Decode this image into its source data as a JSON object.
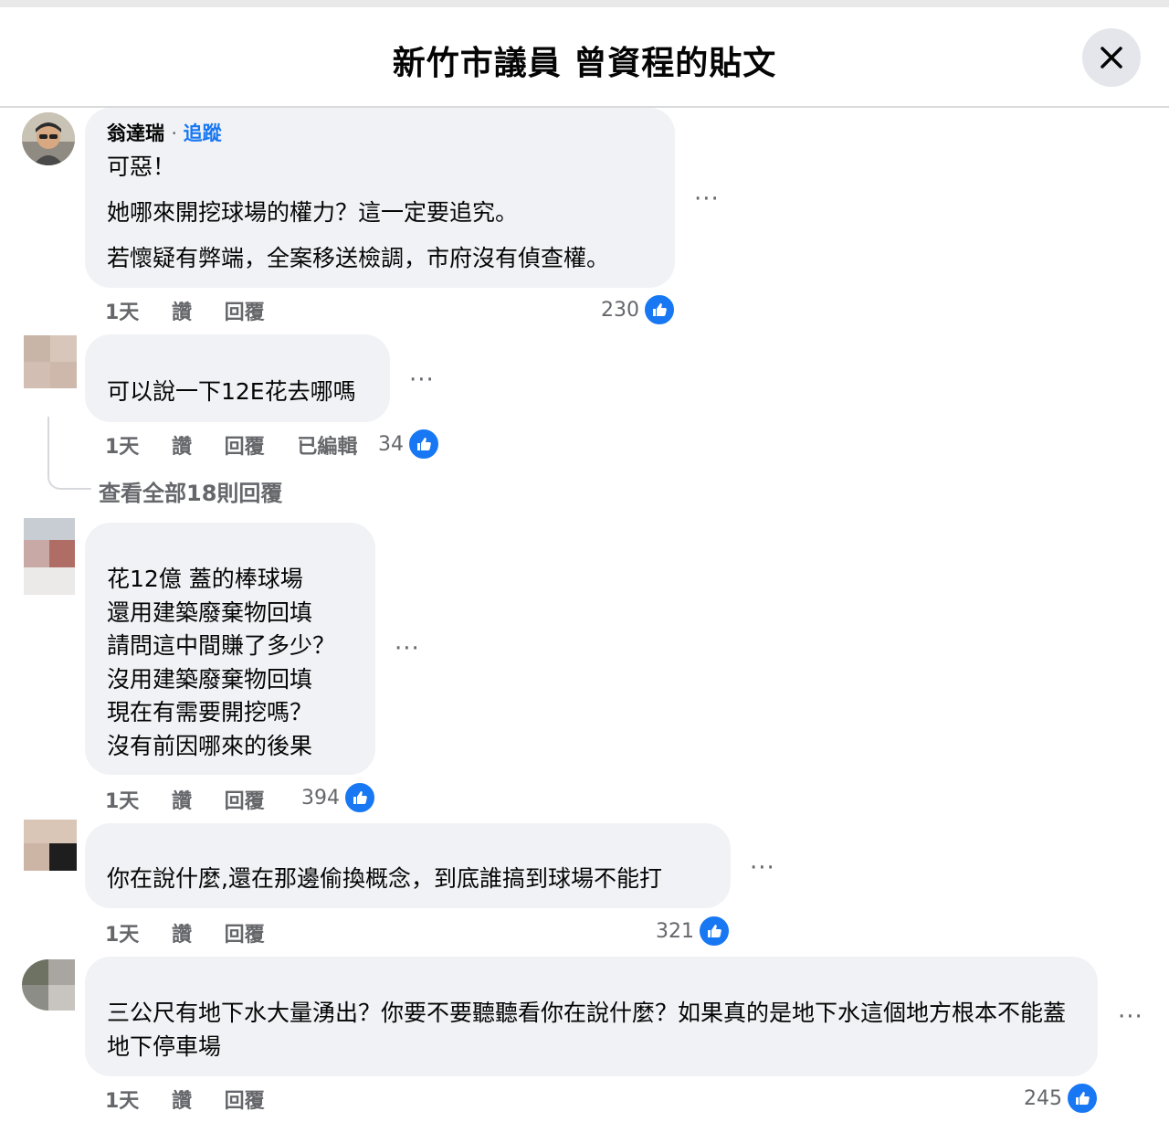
{
  "dialog": {
    "title": "新竹市議員 曾資程的貼文"
  },
  "comments": [
    {
      "author": "翁達瑞",
      "follow_label": "追蹤",
      "lines": [
        "可惡！",
        "她哪來開挖球場的權力？這一定要追究。",
        "若懷疑有弊端，全案移送檢調，市府沒有偵查權。"
      ],
      "time": "1天",
      "like_label": "讚",
      "reply_label": "回覆",
      "likes": "230"
    },
    {
      "lines": [
        "可以說一下12E花去哪嗎"
      ],
      "time": "1天",
      "like_label": "讚",
      "reply_label": "回覆",
      "edited_label": "已編輯",
      "likes": "34",
      "view_replies": "查看全部18則回覆"
    },
    {
      "lines": [
        "花12億 蓋的棒球場",
        "還用建築廢棄物回填",
        "請問這中間賺了多少？",
        "沒用建築廢棄物回填",
        "現在有需要開挖嗎？",
        "沒有前因哪來的後果"
      ],
      "time": "1天",
      "like_label": "讚",
      "reply_label": "回覆",
      "likes": "394"
    },
    {
      "lines": [
        "你在說什麼,還在那邊偷換概念，到底誰搞到球場不能打"
      ],
      "time": "1天",
      "like_label": "讚",
      "reply_label": "回覆",
      "likes": "321"
    },
    {
      "lines": [
        "三公尺有地下水大量湧出？你要不要聽聽看你在說什麼？如果真的是地下水這個地方根本不能蓋地下停車場"
      ],
      "time": "1天",
      "like_label": "讚",
      "reply_label": "回覆",
      "likes": "245"
    }
  ],
  "icons": {
    "close": "close-icon",
    "more": "more-dots-icon",
    "like": "thumbs-up-icon"
  },
  "colors": {
    "accent": "#1877f2",
    "bubble": "#f0f2f5",
    "secondary_text": "#65676b"
  }
}
